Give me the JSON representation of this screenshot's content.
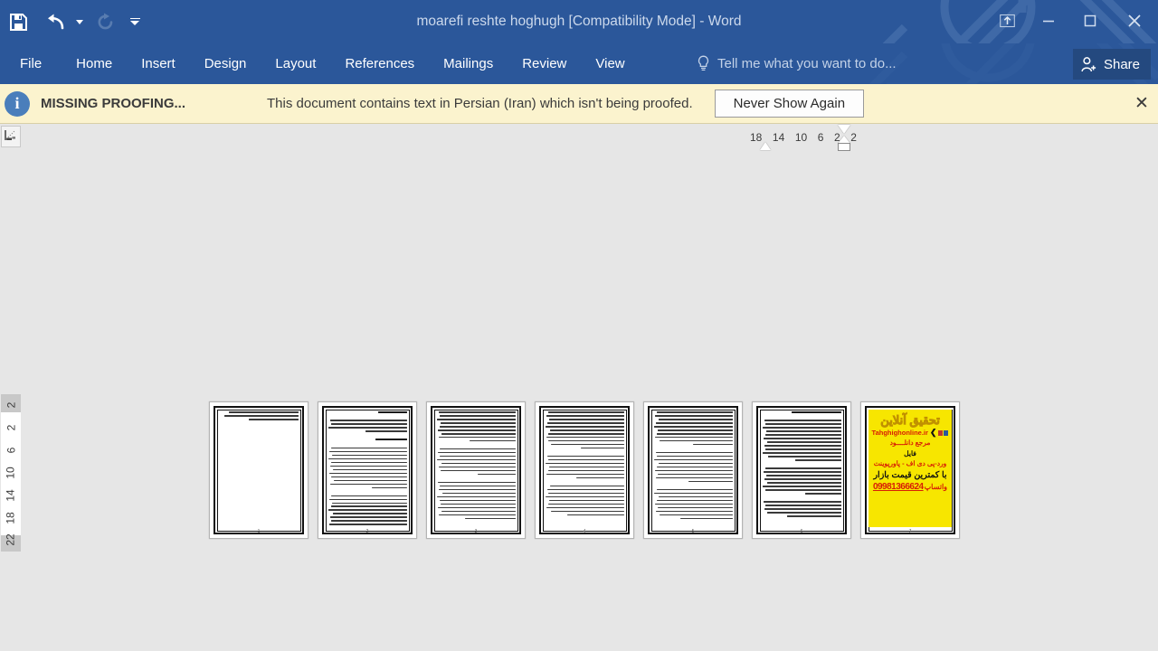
{
  "titlebar": {
    "document_title": "moarefi reshte hoghugh [Compatibility Mode] - Word",
    "quick_access": [
      {
        "name": "save",
        "label": "Save",
        "icon": "save-icon",
        "enabled": true
      },
      {
        "name": "undo",
        "label": "Undo",
        "icon": "undo-icon",
        "enabled": true
      },
      {
        "name": "redo",
        "label": "Repeat",
        "icon": "redo-icon",
        "enabled": false
      },
      {
        "name": "customize",
        "label": "Customize Quick Access Toolbar",
        "icon": "customize-icon",
        "enabled": true
      }
    ],
    "window_controls": [
      {
        "name": "ribbon-display-options",
        "label": "Ribbon Display Options",
        "glyph": "⤒"
      },
      {
        "name": "minimize",
        "label": "Minimize",
        "glyph": "—"
      },
      {
        "name": "restore",
        "label": "Restore Down",
        "glyph": "□"
      },
      {
        "name": "close",
        "label": "Close",
        "glyph": "✕"
      }
    ]
  },
  "ribbon": {
    "tabs": [
      {
        "label": "File"
      },
      {
        "label": "Home"
      },
      {
        "label": "Insert"
      },
      {
        "label": "Design"
      },
      {
        "label": "Layout"
      },
      {
        "label": "References"
      },
      {
        "label": "Mailings"
      },
      {
        "label": "Review"
      },
      {
        "label": "View"
      }
    ],
    "tell_me_placeholder": "Tell me what you want to do...",
    "share_label": "Share",
    "accent_color": "#2b579a"
  },
  "notification": {
    "title": "MISSING PROOFING...",
    "message": "This document contains text in Persian (Iran) which isn't being proofed.",
    "button_label": "Never Show Again",
    "close_glyph": "✕",
    "background_color": "#fbf3ce",
    "icon": "info-icon"
  },
  "rulers": {
    "horizontal_ticks": [
      "18",
      "14",
      "10",
      "6",
      "2",
      "2"
    ],
    "vertical_ticks": [
      "2",
      "2",
      "6",
      "10",
      "14",
      "18",
      "22"
    ],
    "corner_button": "tab-selector"
  },
  "document": {
    "zoom_view": "multiple-pages",
    "page_count": 7,
    "pages": [
      {
        "index": 1,
        "kind": "text",
        "page_number": "1",
        "line_counts": [
          3
        ]
      },
      {
        "index": 2,
        "kind": "text",
        "page_number": "2",
        "line_counts": [
          1,
          4,
          1,
          12,
          12
        ]
      },
      {
        "index": 3,
        "kind": "text",
        "page_number": "3",
        "line_counts": [
          9,
          8,
          11
        ]
      },
      {
        "index": 4,
        "kind": "text",
        "page_number": "4",
        "line_counts": [
          11,
          7,
          9
        ]
      },
      {
        "index": 5,
        "kind": "text",
        "page_number": "5",
        "line_counts": [
          10,
          9,
          9
        ]
      },
      {
        "index": 6,
        "kind": "text",
        "page_number": "6",
        "line_counts": [
          1,
          12,
          8,
          5
        ]
      },
      {
        "index": 7,
        "kind": "advertisement",
        "page_number": "7"
      }
    ],
    "advertisement": {
      "title": "تحقیق آنلاین",
      "website": "Tahghighonline.ir",
      "line_source": "مرجع دانلــــود",
      "line_file": "فایل",
      "line_formats": "ورد-پی دی اف - پاورپوینت",
      "line_price": "با کمترین قیمت بازار",
      "line_whatsapp": "واتساپ",
      "phone": "09981366624",
      "background_color": "#f7e600",
      "accent_color": "#d81e05"
    },
    "background_color": "#e6e6e6"
  }
}
